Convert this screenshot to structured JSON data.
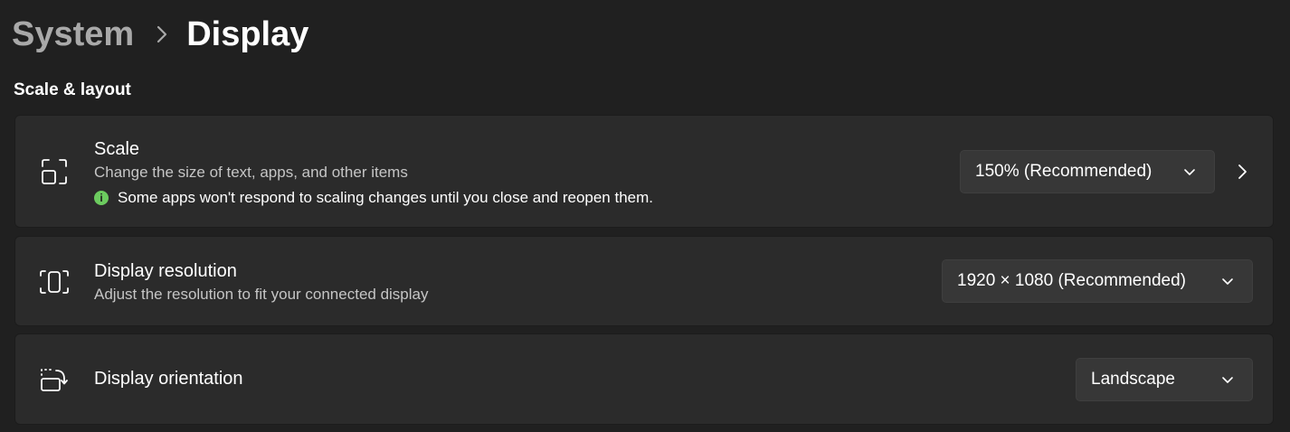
{
  "breadcrumb": {
    "parent": "System",
    "current": "Display",
    "separator_icon": "chevron-right-icon"
  },
  "section": {
    "title": "Scale & layout"
  },
  "scale": {
    "icon": "scale-icon",
    "title": "Scale",
    "description": "Change the size of text, apps, and other items",
    "note": "Some apps won't respond to scaling changes until you close and reopen them.",
    "note_icon": "info-icon",
    "note_icon_color": "#6ccb5f",
    "value": "150% (Recommended)",
    "chevron_icon": "chevron-right-icon"
  },
  "resolution": {
    "icon": "resolution-icon",
    "title": "Display resolution",
    "description": "Adjust the resolution to fit your connected display",
    "value": "1920 × 1080 (Recommended)"
  },
  "orientation": {
    "icon": "orientation-icon",
    "title": "Display orientation",
    "value": "Landscape"
  },
  "colors": {
    "background": "#202020",
    "card": "#2b2b2b",
    "dropdown": "#373737",
    "accent_green": "#6ccb5f"
  }
}
